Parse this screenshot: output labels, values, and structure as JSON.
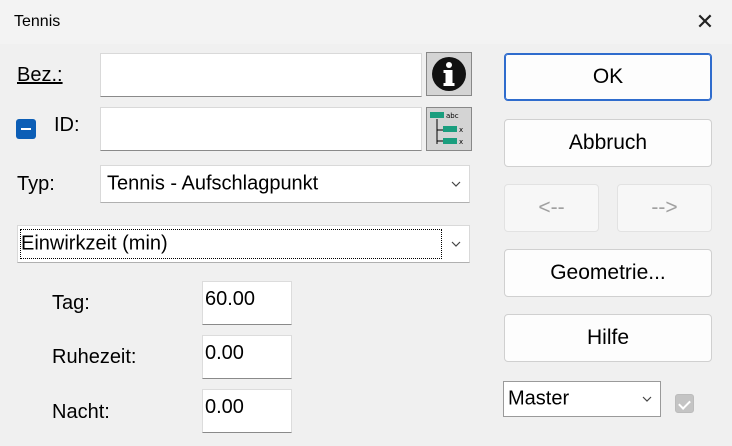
{
  "window": {
    "title": "Tennis",
    "close_glyph": "✕"
  },
  "form": {
    "bez_label": "Bez.:",
    "bez_value": "",
    "id_label": "ID:",
    "id_value": "",
    "typ_label": "Typ:",
    "typ_value": "Tennis - Aufschlagpunkt",
    "mode_value": "Einwirkzeit (min)",
    "rows": [
      {
        "label": "Tag:",
        "value": "60.00"
      },
      {
        "label": "Ruhezeit:",
        "value": "0.00"
      },
      {
        "label": "Nacht:",
        "value": "0.00"
      }
    ]
  },
  "buttons": {
    "ok": "OK",
    "cancel": "Abbruch",
    "prev": "<--",
    "next": "-->",
    "geometry": "Geometrie...",
    "help": "Hilfe"
  },
  "master": {
    "value": "Master",
    "checked": true
  },
  "colors": {
    "accent": "#0c5eb6",
    "ok_border": "#2f6ccd",
    "icon_teal": "#1a9e7e"
  },
  "icons": [
    "info-icon",
    "id-list-icon",
    "close-icon",
    "chevron-down-icon",
    "checkbox-icon"
  ]
}
